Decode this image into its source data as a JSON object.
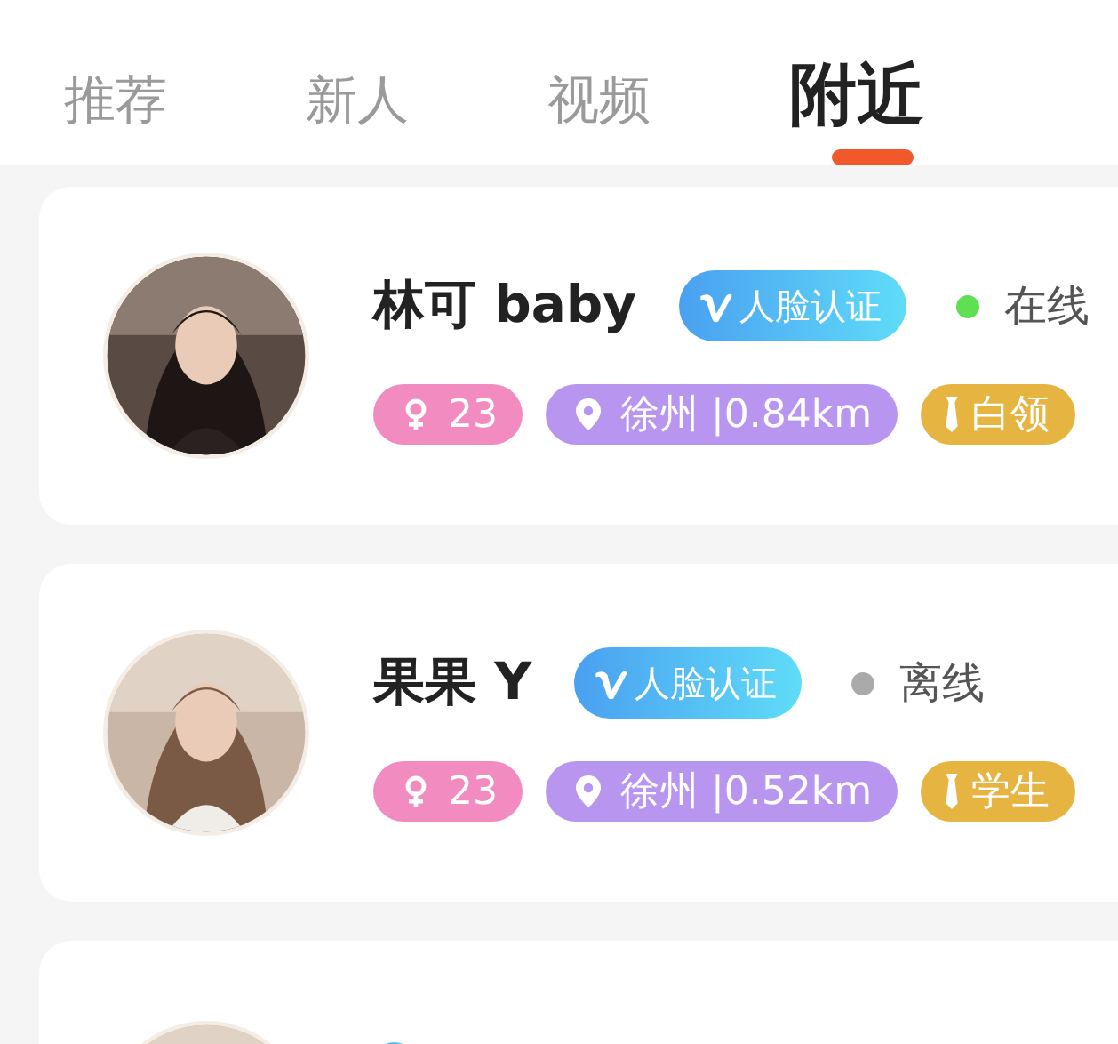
{
  "tabs": [
    {
      "label": "推荐",
      "selected": false
    },
    {
      "label": "新人",
      "selected": false
    },
    {
      "label": "视频",
      "selected": false
    },
    {
      "label": "附近",
      "selected": true
    }
  ],
  "cards": [
    {
      "kind": "full",
      "name": "林可 baby",
      "badge": "人脸认证",
      "online": true,
      "status": "在线",
      "age": "23",
      "location": "徐州 |0.84km",
      "job": "白领"
    },
    {
      "kind": "full",
      "name": "果果 Y",
      "badge": "人脸认证",
      "online": false,
      "status": "离线",
      "age": "23",
      "location": "徐州 |0.52km",
      "job": "学生"
    },
    {
      "kind": "partial"
    }
  ]
}
